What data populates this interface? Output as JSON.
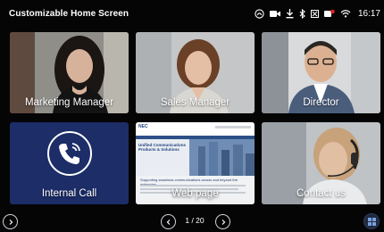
{
  "header": {
    "title": "Customizable Home Screen",
    "time": "16:17"
  },
  "tiles": [
    {
      "label": "Marketing Manager"
    },
    {
      "label": "Sales Manager"
    },
    {
      "label": "Director"
    },
    {
      "label": "Internal Call"
    },
    {
      "label": "Web page"
    },
    {
      "label": "Contact us"
    }
  ],
  "webpage_thumb": {
    "brand": "NEC",
    "headline": "Unified Communications Products & Solutions",
    "subheadline": "Supporting seamless communications across and beyond the enterprise"
  },
  "nav": {
    "page_indicator": "1 / 20"
  },
  "colors": {
    "background": "#050506",
    "call_tile": "#1c2d68",
    "nav_button_border": "#cfd2d7"
  },
  "icons": [
    "headset-status-icon",
    "video-icon",
    "download-icon",
    "bluetooth-icon",
    "signal-off-icon",
    "sim-icon",
    "wifi-icon",
    "phone-call-icon",
    "chevron-left-icon",
    "chevron-right-icon",
    "grid-icon"
  ]
}
